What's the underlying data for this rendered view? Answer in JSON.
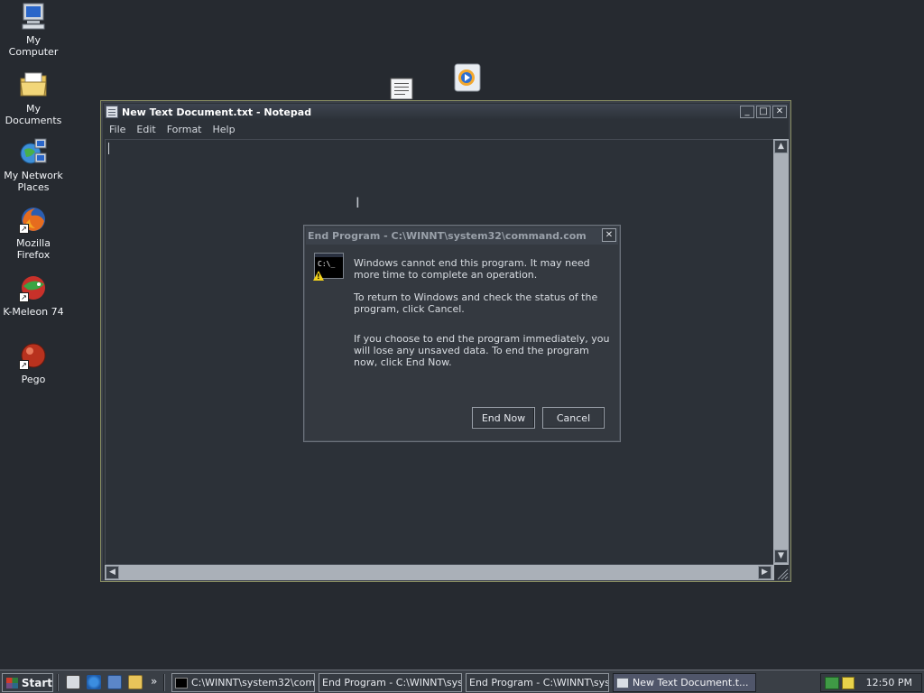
{
  "desktop": {
    "icons": [
      {
        "label": "My Computer",
        "icon": "computer-icon"
      },
      {
        "label": "My Documents",
        "icon": "folder-icon"
      },
      {
        "label": "My Network Places",
        "icon": "network-icon"
      },
      {
        "label": "Mozilla Firefox",
        "icon": "firefox-icon"
      },
      {
        "label": "K-Meleon 74",
        "icon": "kmeleon-icon"
      },
      {
        "label": "Pego",
        "icon": "pego-icon"
      }
    ]
  },
  "notepad": {
    "title": "New Text Document.txt - Notepad",
    "menu": [
      "File",
      "Edit",
      "Format",
      "Help"
    ],
    "controls": {
      "minimize": "_",
      "maximize": "□",
      "close": "✕"
    }
  },
  "dialog": {
    "title": "End Program - C:\\WINNT\\system32\\command.com",
    "icon_text": "C:\\_",
    "paragraphs": [
      "Windows cannot end this program. It may need more time to complete an operation.",
      "To return to Windows and check the status of the program, click Cancel.",
      "If you choose to end the program immediately, you will lose any unsaved data. To end the program now, click End Now."
    ],
    "buttons": {
      "end_now": "End Now",
      "cancel": "Cancel"
    },
    "close": "✕"
  },
  "taskbar": {
    "start_label": "Start",
    "overflow": "»",
    "tasks": [
      {
        "label": "C:\\WINNT\\system32\\com...",
        "active": false
      },
      {
        "label": "End Program - C:\\WINNT\\sys...",
        "active": false
      },
      {
        "label": "End Program - C:\\WINNT\\sys...",
        "active": false
      },
      {
        "label": "New Text Document.t...",
        "active": true
      }
    ],
    "clock": "12:50 PM"
  },
  "colors": {
    "desktop": "#262a30",
    "window": "#2c3138",
    "scrollbar": "#aab0b8",
    "active_task": "#50566a"
  }
}
